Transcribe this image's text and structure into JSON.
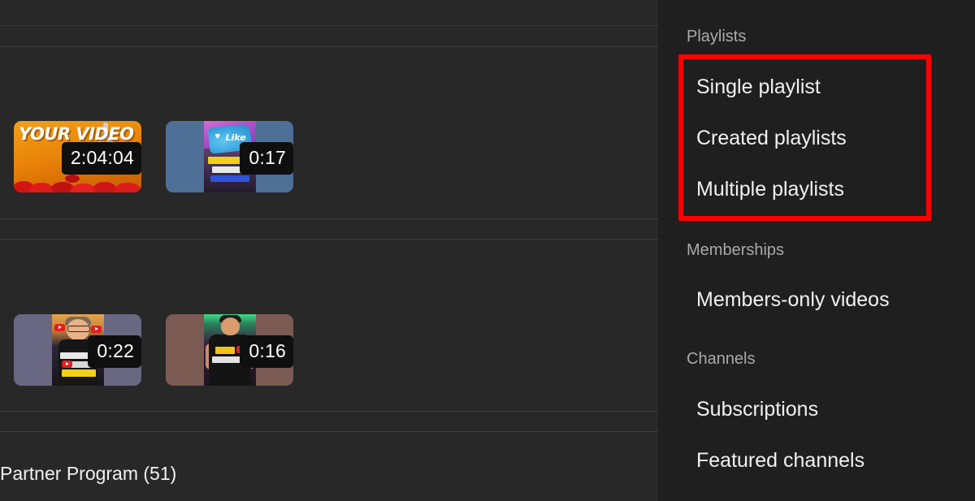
{
  "theme": {
    "content_bg": "#282828",
    "sidebar_bg": "#1f1f1f",
    "divider": "#3d3d3d",
    "text_primary": "#f1f1f1",
    "text_secondary": "#aaaaaa",
    "highlight": "#fe0000",
    "duration_bg": "#0f0f0f"
  },
  "content": {
    "rows": [
      {
        "videos": [
          {
            "duration": "2:04:04",
            "thumb_style": "your-video-orange",
            "overlay_text": "YOUR VIDEO"
          },
          {
            "duration": "0:17",
            "thumb_style": "shorts-blue",
            "overlay_text": "Like"
          }
        ]
      },
      {
        "videos": [
          {
            "duration": "0:22",
            "thumb_style": "shorts-purple",
            "overlay_text": ""
          },
          {
            "duration": "0:16",
            "thumb_style": "shorts-brown",
            "overlay_text": ""
          }
        ]
      }
    ],
    "bottom_label": "Partner Program (51)"
  },
  "sidebar": {
    "sections": [
      {
        "header": "Playlists",
        "items": [
          {
            "label": "Single playlist"
          },
          {
            "label": "Created playlists"
          },
          {
            "label": "Multiple playlists"
          }
        ],
        "highlighted": true
      },
      {
        "header": "Memberships",
        "items": [
          {
            "label": "Members-only videos"
          }
        ],
        "highlighted": false
      },
      {
        "header": "Channels",
        "items": [
          {
            "label": "Subscriptions"
          },
          {
            "label": "Featured channels"
          }
        ],
        "highlighted": false
      }
    ]
  }
}
